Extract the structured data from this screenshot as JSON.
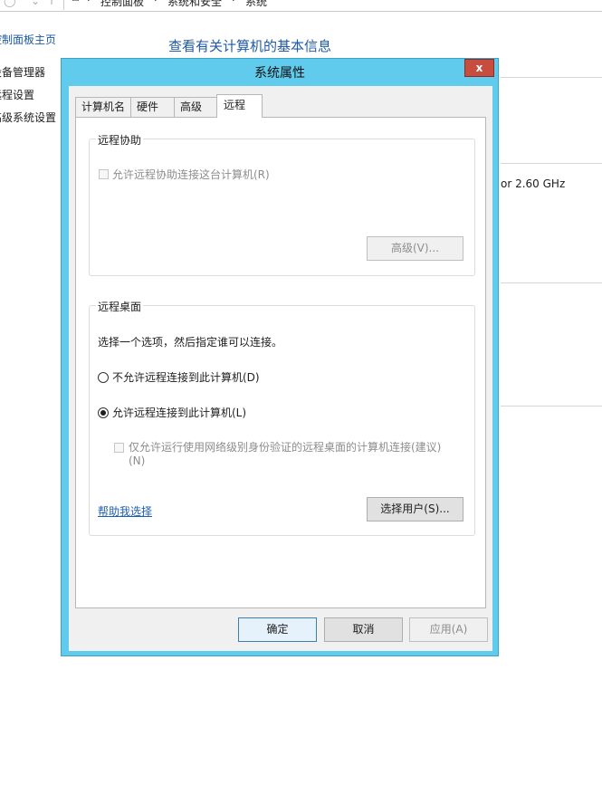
{
  "background": {
    "breadcrumb": [
      "控制面板",
      "系统和安全",
      "系统"
    ],
    "sidebar": {
      "home": "控制面板主页",
      "items": [
        "设备管理器",
        "远程设置",
        "高级系统设置"
      ]
    },
    "main_title": "查看有关计算机的基本信息",
    "processor_fragment": "or   2.60 GHz"
  },
  "dialog": {
    "title": "系统属性",
    "close_glyph": "x",
    "tabs": [
      "计算机名",
      "硬件",
      "高级",
      "远程"
    ],
    "selected_tab": "远程",
    "remote_assistance": {
      "group_label": "远程协助",
      "allow_checkbox": "允许远程协助连接这台计算机(R)",
      "advanced_button": "高级(V)..."
    },
    "remote_desktop": {
      "group_label": "远程桌面",
      "instruction": "选择一个选项，然后指定谁可以连接。",
      "option_deny": "不允许远程连接到此计算机(D)",
      "option_allow": "允许远程连接到此计算机(L)",
      "nla_line1": "仅允许运行使用网络级别身份验证的远程桌面的计算机连接(建议)",
      "nla_line2": "(N)",
      "help_link": "帮助我选择",
      "select_users_button": "选择用户(S)..."
    },
    "footer": {
      "ok": "确定",
      "cancel": "取消",
      "apply": "应用(A)"
    }
  },
  "colors": {
    "dialog_frame": "#60cbed",
    "close_button": "#c74d3f",
    "link": "#1e5fb3",
    "heading": "#1e5aa8"
  }
}
